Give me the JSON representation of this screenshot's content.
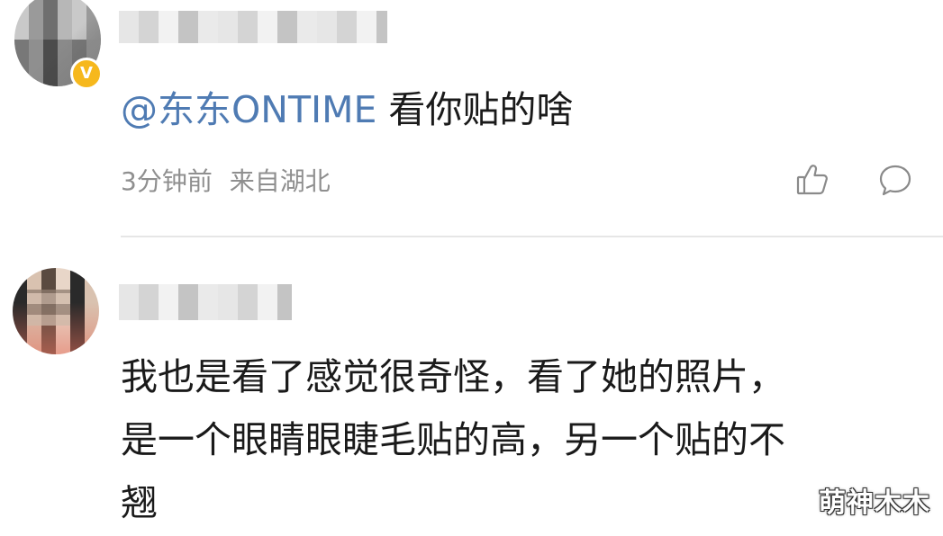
{
  "comments": [
    {
      "mention": "@东东ONTIME",
      "text": " 看你贴的啥",
      "time": "3分钟前",
      "location": "来自湖北",
      "verified_mark": "V",
      "icons": [
        "like-icon",
        "reply-icon"
      ]
    },
    {
      "lines": [
        "我也是看了感觉很奇怪，看了她的照片，",
        "是一个眼睛眼睫毛贴的高，另一个贴的不",
        "翘"
      ]
    }
  ],
  "watermark": "萌神木木",
  "colors": {
    "mention": "#4f7bb3",
    "text": "#1a1a1a",
    "meta": "#8f8f8f",
    "badge": "#f6b81d",
    "divider": "#e6e6e6"
  }
}
